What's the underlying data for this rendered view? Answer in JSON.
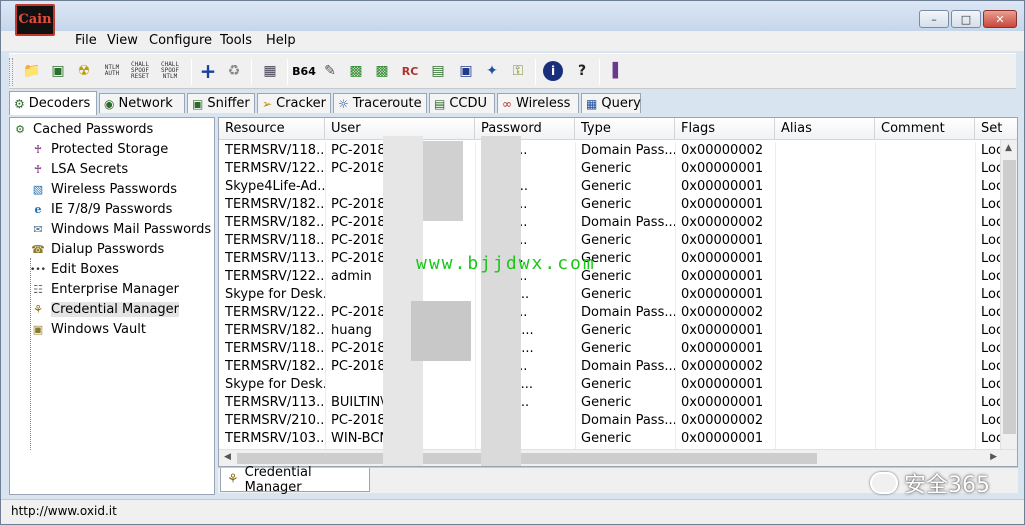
{
  "app": {
    "logo_text": "Cain",
    "window_buttons": [
      "minimize",
      "maximize",
      "close"
    ]
  },
  "menu": [
    "File",
    "View",
    "Configure",
    "Tools",
    "Help"
  ],
  "toolbar": {
    "icons": [
      "open-folder-icon",
      "load-icon",
      "radiation-icon",
      "ntlm-auth-icon",
      "chall-spoof-reset-icon",
      "chall-spoof-ntlm-icon",
      "add-icon",
      "recycle-icon",
      "tools-icon",
      "base64-icon",
      "pencil-icon",
      "hash-icon",
      "hash2-icon",
      "rc-icon",
      "ram-icon",
      "chip-icon",
      "network-icon",
      "key-icon",
      "info-icon",
      "help-icon",
      "exit-icon"
    ],
    "labels": {
      "ntlm_auth": "NTLM AUTH",
      "chall_spoof_reset": "CHALL SPOOF RESET",
      "chall_spoof_ntlm": "CHALL SPOOF NTLM",
      "base64": "B64"
    }
  },
  "tabs": [
    "Decoders",
    "Network",
    "Sniffer",
    "Cracker",
    "Traceroute",
    "CCDU",
    "Wireless",
    "Query"
  ],
  "tree": {
    "root": "Cached Passwords",
    "items": [
      "Protected Storage",
      "LSA Secrets",
      "Wireless Passwords",
      "IE 7/8/9 Passwords",
      "Windows Mail Passwords",
      "Dialup Passwords",
      "Edit Boxes",
      "Enterprise Manager",
      "Credential Manager",
      "Windows Vault"
    ],
    "selected": "Credential Manager"
  },
  "grid": {
    "columns": [
      "Resource",
      "User",
      "Password",
      "Type",
      "Flags",
      "Alias",
      "Comment",
      "Set"
    ],
    "rows": [
      [
        "TERMSRV/118....",
        "PC-2018112",
        "...d...",
        "KAUL...",
        "Domain Pass...",
        "0x00000002",
        "",
        "",
        "Loc"
      ],
      [
        "TERMSRV/122....",
        "PC-2018111",
        "",
        "",
        "Generic",
        "0x00000001",
        "",
        "",
        "Loc"
      ],
      [
        "Skype4Life-Ad...",
        "",
        "",
        "ope\":...",
        "Generic",
        "0x00000001",
        "",
        "",
        "Loc"
      ],
      [
        "TERMSRV/182....",
        "PC-2018",
        "",
        "KAUL...",
        "Generic",
        "0x00000001",
        "",
        "",
        "Loc"
      ],
      [
        "TERMSRV/182....",
        "PC-2018",
        "",
        "KAUL...",
        "Domain Pass...",
        "0x00000002",
        "",
        "",
        "Loc"
      ],
      [
        "TERMSRV/118....",
        "PC-2018",
        "",
        "KAUL...",
        "Generic",
        "0x00000001",
        "",
        "",
        "Loc"
      ],
      [
        "TERMSRV/113....",
        "PC-2018",
        "",
        "mBjt...",
        "Generic",
        "0x00000001",
        "",
        "",
        "Loc"
      ],
      [
        "TERMSRV/122....",
        "admin",
        "",
        "KAUL...",
        "Generic",
        "0x00000001",
        "",
        "",
        "Loc"
      ],
      [
        "Skype for Desk...",
        "",
        "",
        "mLk1...",
        "Generic",
        "0x00000001",
        "",
        "",
        "Loc"
      ],
      [
        "TERMSRV/122....",
        "PC-2018",
        "",
        "KAUL...",
        "Domain Pass...",
        "0x00000002",
        "",
        "",
        "Loc"
      ],
      [
        "TERMSRV/182....",
        "huang",
        "",
        "MbZ0j...",
        "Generic",
        "0x00000001",
        "",
        "",
        "Loc"
      ],
      [
        "TERMSRV/118....",
        "PC-20181",
        "",
        "MbZ0j...",
        "Generic",
        "0x00000001",
        "",
        "",
        "Loc"
      ],
      [
        "TERMSRV/182....",
        "PC-20181",
        "",
        "KAUL...",
        "Domain Pass...",
        "0x00000002",
        "",
        "",
        "Loc"
      ],
      [
        "Skype for Desk...",
        "",
        "",
        "ken\":\"...",
        "Generic",
        "0x00000001",
        "",
        "",
        "Loc"
      ],
      [
        "TERMSRV/113....",
        "BUILTIN\\a",
        "",
        "018=...",
        "Generic",
        "0x00000001",
        "",
        "",
        "Loc"
      ],
      [
        "TERMSRV/210....",
        "PC-2018111",
        "",
        "017...",
        "Domain Pass...",
        "0x00000002",
        "",
        "",
        "Loc"
      ],
      [
        "TERMSRV/103....",
        "WIN-BCNC",
        "...\\...",
        "7g2Q",
        "Generic",
        "0x00000001",
        "",
        "",
        "Loc"
      ]
    ]
  },
  "bottom_tab": "Credential Manager",
  "status": "http://www.oxid.it",
  "watermark": "www.bjjdwx.com",
  "brand_overlay": "安全365"
}
